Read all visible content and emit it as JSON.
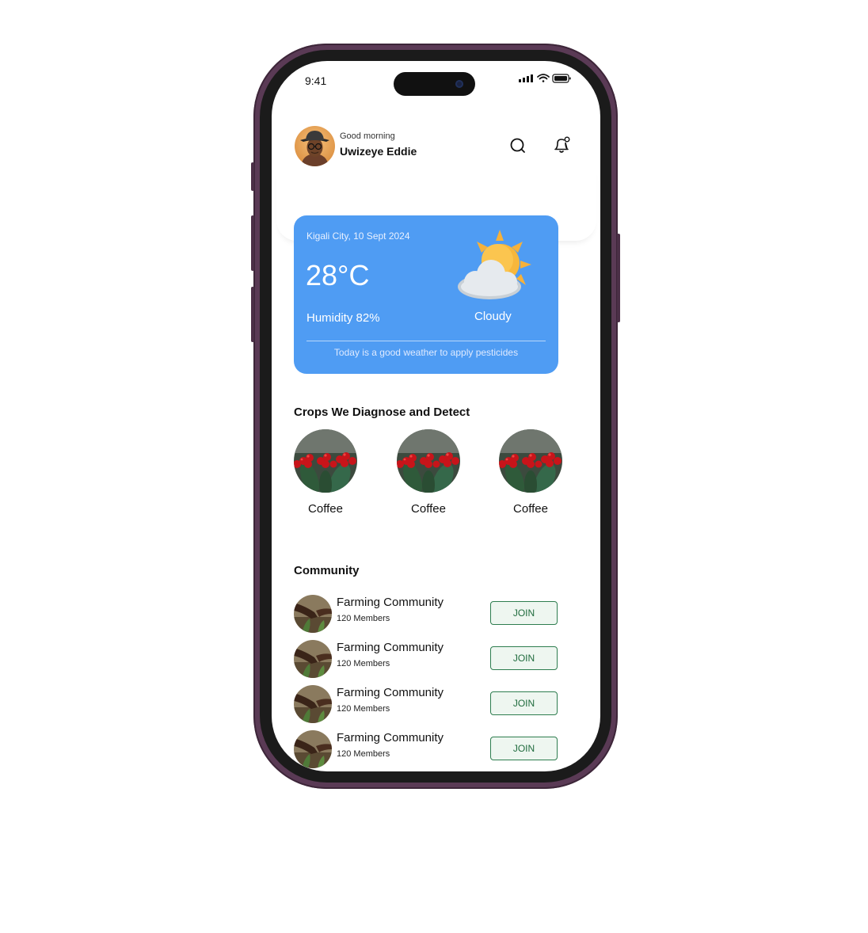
{
  "status_bar": {
    "time": "9:41"
  },
  "header": {
    "greeting": "Good morning",
    "user_name": "Uwizeye Eddie"
  },
  "weather": {
    "location_date": "Kigali City, 10 Sept 2024",
    "temperature": "28°C",
    "humidity": "Humidity 82%",
    "condition": "Cloudy",
    "tip": "Today is a good weather to apply pesticides",
    "card_color": "#4f9cf3"
  },
  "crops": {
    "title": "Crops We Diagnose and Detect",
    "items": [
      {
        "label": "Coffee"
      },
      {
        "label": "Coffee"
      },
      {
        "label": "Coffee"
      }
    ]
  },
  "community": {
    "title": "Community",
    "items": [
      {
        "name": "Farming Community",
        "members": "120 Members",
        "action": "JOIN"
      },
      {
        "name": "Farming Community",
        "members": "120 Members",
        "action": "JOIN"
      },
      {
        "name": "Farming Community",
        "members": "120 Members",
        "action": "JOIN"
      },
      {
        "name": "Farming Community",
        "members": "120 Members",
        "action": "JOIN"
      }
    ]
  },
  "colors": {
    "accent_green": "#2e7d4f",
    "phone_frame": "#5a3a55"
  }
}
